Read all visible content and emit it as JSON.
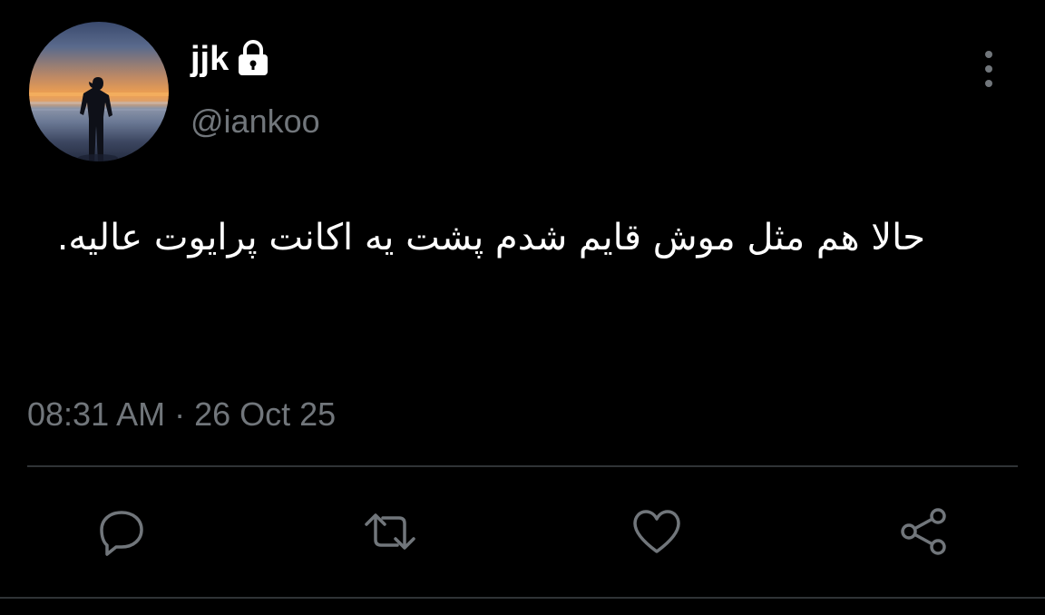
{
  "user": {
    "display_name": "jjk",
    "handle": "@iankoo",
    "protected": true
  },
  "tweet": {
    "text": "حالا هم مثل موش قایم شدم پشت یه اکانت پرایوت عالیه.",
    "time": "08:31 AM",
    "separator": "·",
    "date": "26 Oct 25"
  },
  "icons": {
    "more": "more-vertical-icon",
    "lock": "lock-icon",
    "reply": "reply-icon",
    "retweet": "retweet-icon",
    "like": "heart-icon",
    "share": "share-icon"
  },
  "colors": {
    "background": "#000000",
    "primary_text": "#ffffff",
    "secondary_text": "#71767b",
    "divider": "#2f3336",
    "icon": "#71767b"
  }
}
